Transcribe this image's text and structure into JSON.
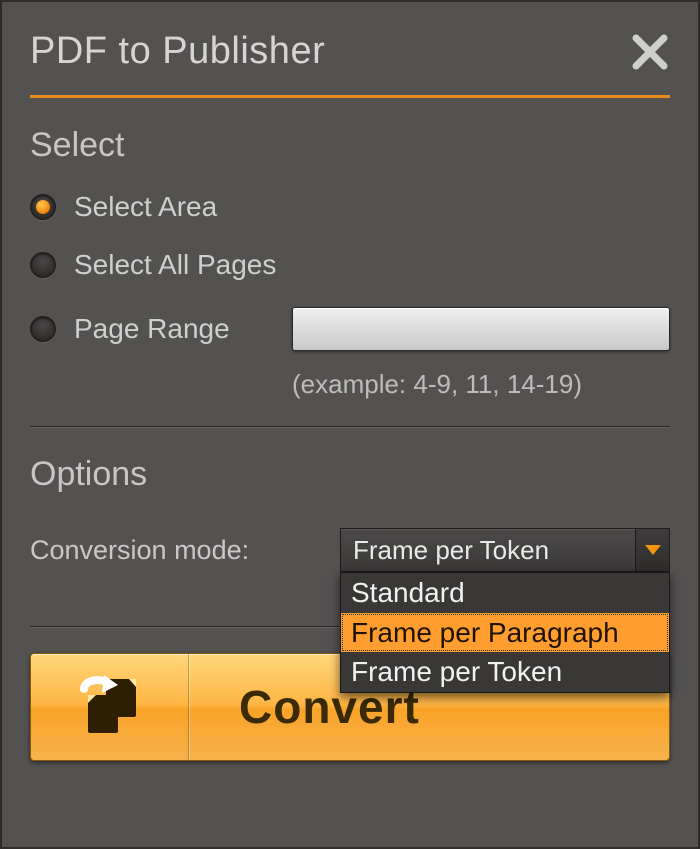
{
  "header": {
    "title": "PDF to Publisher"
  },
  "select": {
    "heading": "Select",
    "options": [
      {
        "label": "Select Area",
        "selected": true
      },
      {
        "label": "Select All Pages",
        "selected": false
      },
      {
        "label": "Page Range",
        "selected": false
      }
    ],
    "range_value": "",
    "example": "(example: 4-9, 11, 14-19)"
  },
  "options": {
    "heading": "Options",
    "mode_label": "Conversion mode:",
    "mode_value": "Frame per Token",
    "mode_items": [
      {
        "label": "Standard",
        "highlighted": false
      },
      {
        "label": "Frame per Paragraph",
        "highlighted": true
      },
      {
        "label": "Frame per Token",
        "highlighted": false
      }
    ]
  },
  "actions": {
    "convert_label": "Convert"
  }
}
